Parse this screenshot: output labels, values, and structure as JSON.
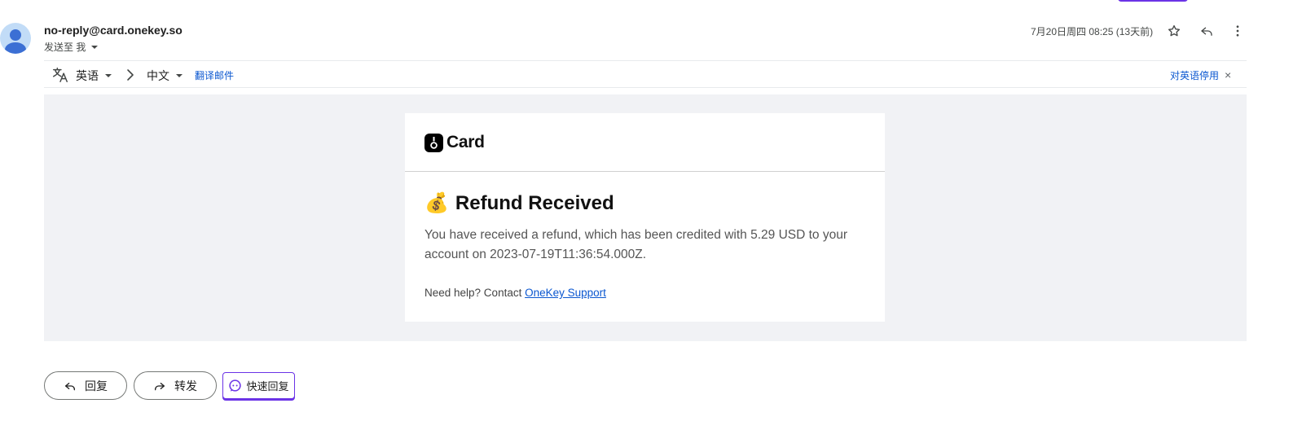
{
  "header": {
    "sender": "no-reply@card.onekey.so",
    "recipient": "发送至 我",
    "timestamp": "7月20日周四 08:25 (13天前)",
    "icons": {
      "star": "star-icon",
      "reply": "reply-icon",
      "more": "more-vert-icon"
    }
  },
  "translate": {
    "source_lang": "英语",
    "target_lang": "中文",
    "translate_link": "翻译邮件",
    "disable_link": "对英语停用",
    "close": "×"
  },
  "email": {
    "brand": "Card",
    "title_emoji": "💰",
    "title": "Refund Received",
    "body": "You have received a refund, which has been credited with 5.29 USD to your account on 2023-07-19T11:36:54.000Z.",
    "help_prefix": "Need help? Contact ",
    "help_link": "OneKey Support"
  },
  "actions": {
    "reply": "回复",
    "forward": "转发",
    "quick_reply": "快速回复"
  },
  "colors": {
    "accent": "#6b33e6",
    "link": "#0b57d0",
    "email_bg": "#f1f2f5"
  }
}
